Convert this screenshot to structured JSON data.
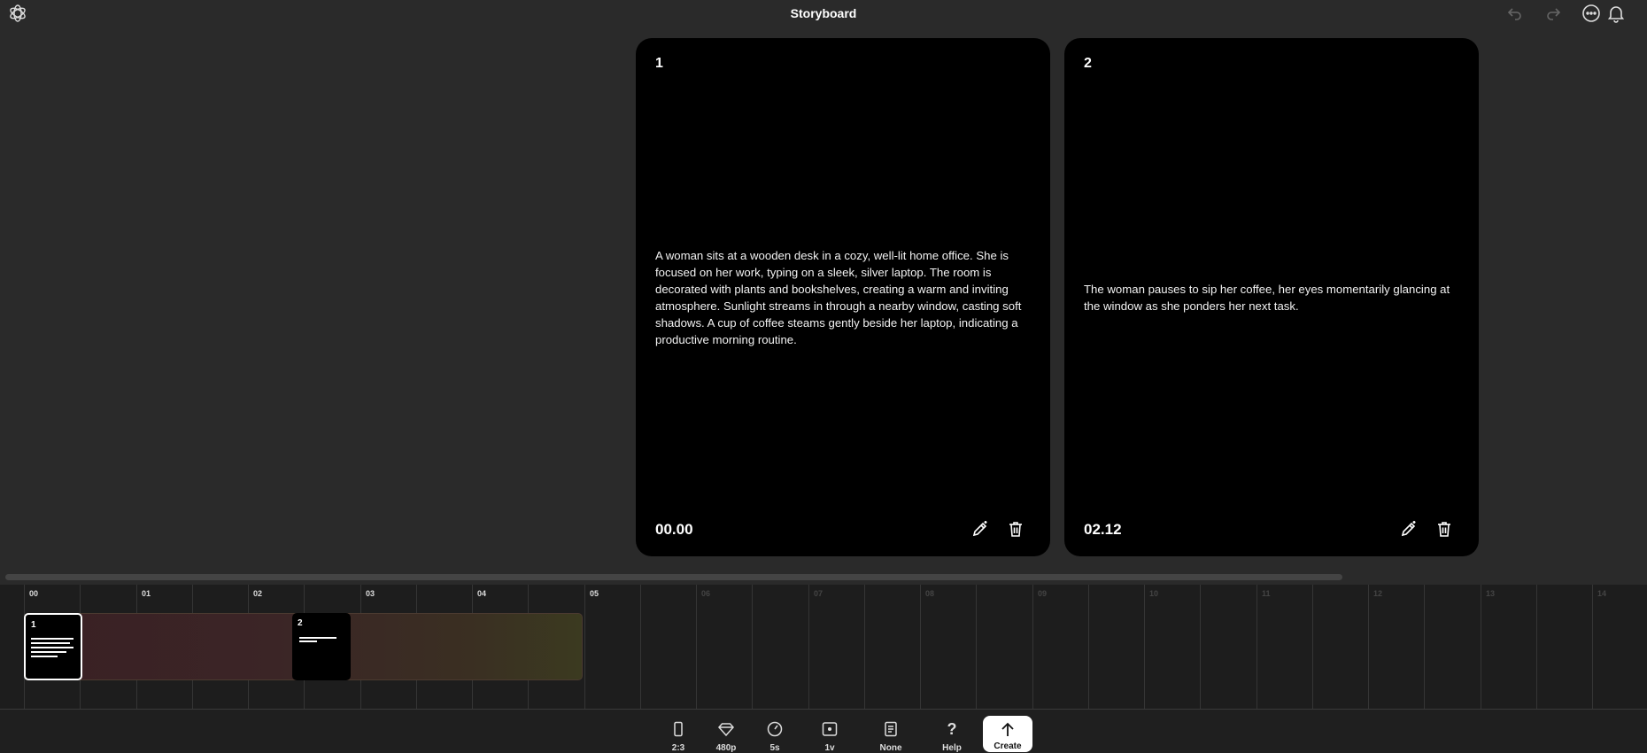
{
  "app": {
    "title": "Storyboard",
    "logo": "openai-logo"
  },
  "header": {
    "undo_icon": "undo-icon",
    "redo_icon": "redo-icon",
    "more_icon": "more-horizontal-icon",
    "notifications_icon": "bell-icon"
  },
  "cards": [
    {
      "number": "1",
      "description": "A woman sits at a wooden desk in a cozy, well-lit home office. She is focused on her work, typing on a sleek, silver laptop. The room is decorated with plants and bookshelves, creating a warm and inviting atmosphere. Sunlight streams in through a nearby window, casting soft shadows. A cup of coffee steams gently beside her laptop, indicating a productive morning routine.",
      "time": "00.00"
    },
    {
      "number": "2",
      "description": "The woman pauses to sip her coffee, her eyes momentarily glancing at the window as she ponders her next task.",
      "time": "02.12"
    }
  ],
  "timeline": {
    "ticks": [
      "00",
      "01",
      "02",
      "03",
      "04",
      "05",
      "06",
      "07",
      "08",
      "09",
      "10",
      "11",
      "12",
      "13",
      "14"
    ],
    "active_ticks": 6,
    "clips": [
      {
        "label": "1",
        "selected": true
      },
      {
        "label": "2",
        "selected": false
      }
    ]
  },
  "toolbar": {
    "items": [
      {
        "icon": "aspect-ratio-icon",
        "label": "2:3"
      },
      {
        "icon": "resolution-diamond-icon",
        "label": "480p"
      },
      {
        "icon": "duration-timer-icon",
        "label": "5s"
      },
      {
        "icon": "variations-icon",
        "label": "1v"
      },
      {
        "icon": "preset-icon",
        "label": "None"
      },
      {
        "icon": "help-icon",
        "label": "Help"
      }
    ],
    "create_label": "Create"
  },
  "colors": {
    "background": "#2a2a2a",
    "card": "#000000",
    "timeline": "#1d1d1d",
    "accent": "#ffffff"
  }
}
